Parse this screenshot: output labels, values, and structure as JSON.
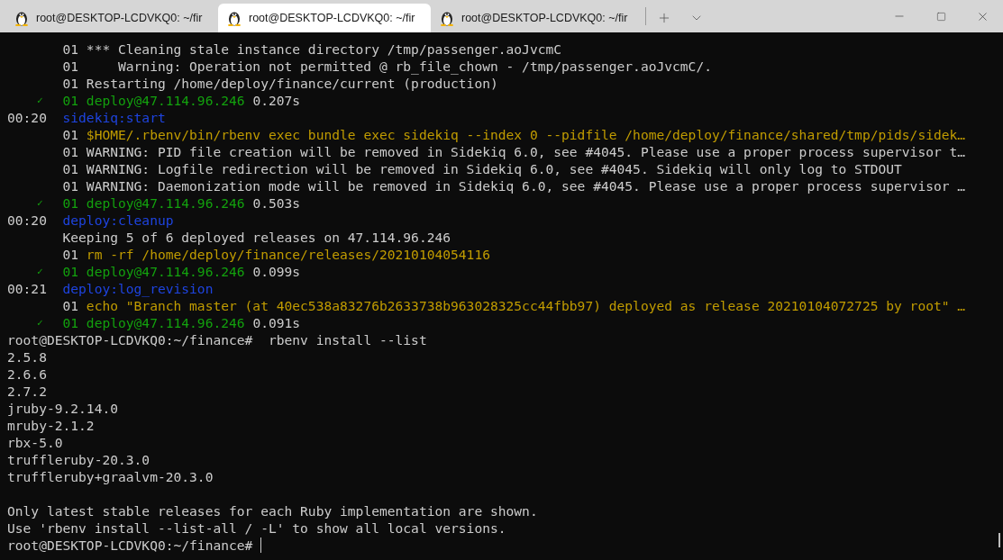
{
  "tabs": [
    {
      "title": "root@DESKTOP-LCDVKQ0: ~/fir",
      "selected": false
    },
    {
      "title": "root@DESKTOP-LCDVKQ0: ~/fir",
      "selected": true
    },
    {
      "title": "root@DESKTOP-LCDVKQ0: ~/fir",
      "selected": false
    }
  ],
  "terminal": {
    "lines": [
      {
        "gutter": {
          "kind": "blank"
        },
        "segments": [
          {
            "kind": "plain",
            "text": "01 *** Cleaning stale instance directory /tmp/passenger.aoJvcmC"
          }
        ]
      },
      {
        "gutter": {
          "kind": "blank"
        },
        "segments": [
          {
            "kind": "plain",
            "text": "01     Warning: Operation not permitted @ rb_file_chown - /tmp/passenger.aoJvcmC/."
          }
        ]
      },
      {
        "gutter": {
          "kind": "blank"
        },
        "segments": [
          {
            "kind": "plain",
            "text": "01 Restarting /home/deploy/finance/current (production)"
          }
        ]
      },
      {
        "gutter": {
          "kind": "check",
          "text": "✓"
        },
        "segments": [
          {
            "kind": "host",
            "text": "01 deploy@47.114.96.246"
          },
          {
            "kind": "plain",
            "text": " 0.207s"
          }
        ]
      },
      {
        "gutter": {
          "kind": "time",
          "text": "00:20"
        },
        "segments": [
          {
            "kind": "task",
            "text": "sidekiq:start"
          }
        ]
      },
      {
        "gutter": {
          "kind": "blank"
        },
        "segments": [
          {
            "kind": "plain",
            "text": "01 "
          },
          {
            "kind": "command",
            "text": "$HOME/.rbenv/bin/rbenv exec bundle exec sidekiq --index 0 --pidfile /home/deploy/finance/shared/tmp/pids/sidek…"
          }
        ]
      },
      {
        "gutter": {
          "kind": "blank"
        },
        "segments": [
          {
            "kind": "plain",
            "text": "01 WARNING: PID file creation will be removed in Sidekiq 6.0, see #4045. Please use a proper process supervisor t…"
          }
        ]
      },
      {
        "gutter": {
          "kind": "blank"
        },
        "segments": [
          {
            "kind": "plain",
            "text": "01 WARNING: Logfile redirection will be removed in Sidekiq 6.0, see #4045. Sidekiq will only log to STDOUT"
          }
        ]
      },
      {
        "gutter": {
          "kind": "blank"
        },
        "segments": [
          {
            "kind": "plain",
            "text": "01 WARNING: Daemonization mode will be removed in Sidekiq 6.0, see #4045. Please use a proper process supervisor …"
          }
        ]
      },
      {
        "gutter": {
          "kind": "check",
          "text": "✓"
        },
        "segments": [
          {
            "kind": "host",
            "text": "01 deploy@47.114.96.246"
          },
          {
            "kind": "plain",
            "text": " 0.503s"
          }
        ]
      },
      {
        "gutter": {
          "kind": "time",
          "text": "00:20"
        },
        "segments": [
          {
            "kind": "task",
            "text": "deploy:cleanup"
          }
        ]
      },
      {
        "gutter": {
          "kind": "blank"
        },
        "segments": [
          {
            "kind": "plain",
            "text": "Keeping 5 of 6 deployed releases on 47.114.96.246"
          }
        ]
      },
      {
        "gutter": {
          "kind": "blank"
        },
        "segments": [
          {
            "kind": "plain",
            "text": "01 "
          },
          {
            "kind": "command",
            "text": "rm -rf /home/deploy/finance/releases/20210104054116"
          }
        ]
      },
      {
        "gutter": {
          "kind": "check",
          "text": "✓"
        },
        "segments": [
          {
            "kind": "host",
            "text": "01 deploy@47.114.96.246"
          },
          {
            "kind": "plain",
            "text": " 0.099s"
          }
        ]
      },
      {
        "gutter": {
          "kind": "time",
          "text": "00:21"
        },
        "segments": [
          {
            "kind": "task",
            "text": "deploy:log_revision"
          }
        ]
      },
      {
        "gutter": {
          "kind": "blank"
        },
        "segments": [
          {
            "kind": "plain",
            "text": "01 "
          },
          {
            "kind": "command",
            "text": "echo \"Branch master (at 40ec538a83276b2633738b963028325cc44fbb97) deployed as release 20210104072725 by root\" …"
          }
        ]
      },
      {
        "gutter": {
          "kind": "check",
          "text": "✓"
        },
        "segments": [
          {
            "kind": "host",
            "text": "01 deploy@47.114.96.246"
          },
          {
            "kind": "plain",
            "text": " 0.091s"
          }
        ]
      },
      {
        "segments": [
          {
            "kind": "plain",
            "text": "root@DESKTOP-LCDVKQ0:~/finance#  rbenv install --list"
          }
        ]
      },
      {
        "segments": [
          {
            "kind": "plain",
            "text": "2.5.8"
          }
        ]
      },
      {
        "segments": [
          {
            "kind": "plain",
            "text": "2.6.6"
          }
        ]
      },
      {
        "segments": [
          {
            "kind": "plain",
            "text": "2.7.2"
          }
        ]
      },
      {
        "segments": [
          {
            "kind": "plain",
            "text": "jruby-9.2.14.0"
          }
        ]
      },
      {
        "segments": [
          {
            "kind": "plain",
            "text": "mruby-2.1.2"
          }
        ]
      },
      {
        "segments": [
          {
            "kind": "plain",
            "text": "rbx-5.0"
          }
        ]
      },
      {
        "segments": [
          {
            "kind": "plain",
            "text": "truffleruby-20.3.0"
          }
        ]
      },
      {
        "segments": [
          {
            "kind": "plain",
            "text": "truffleruby+graalvm-20.3.0"
          }
        ]
      },
      {
        "blank_before": true,
        "segments": [
          {
            "kind": "plain",
            "text": "Only latest stable releases for each Ruby implementation are shown."
          }
        ]
      },
      {
        "segments": [
          {
            "kind": "plain",
            "text": "Use 'rbenv install --list-all / -L' to show all local versions."
          }
        ]
      },
      {
        "cursor": true,
        "segments": [
          {
            "kind": "plain",
            "text": "root@DESKTOP-LCDVKQ0:~/finance# "
          }
        ]
      }
    ]
  }
}
